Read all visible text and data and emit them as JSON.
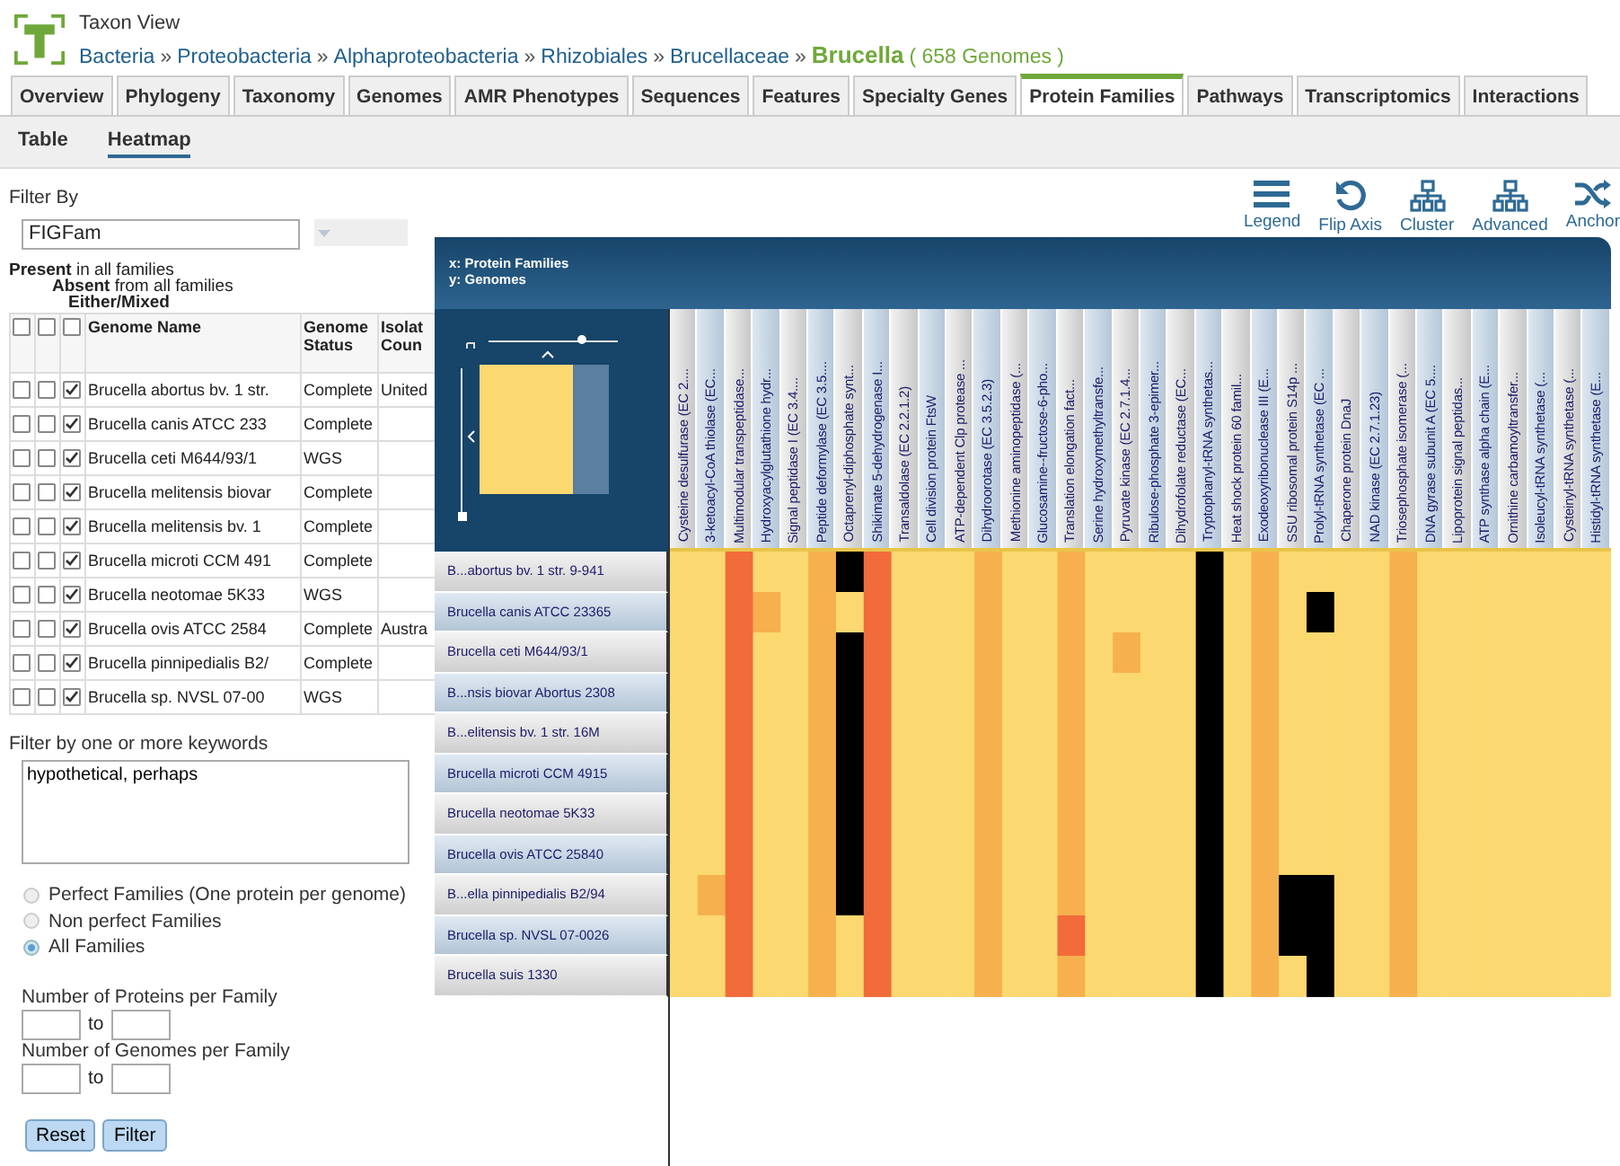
{
  "header": {
    "title": "Taxon View",
    "breadcrumb": [
      {
        "label": "Bacteria",
        "separator": "»"
      },
      {
        "label": "Proteobacteria",
        "separator": "»"
      },
      {
        "label": "Alphaproteobacteria",
        "separator": "»"
      },
      {
        "label": "Rhizobiales",
        "separator": "»"
      },
      {
        "label": "Brucellaceae",
        "separator": "»"
      }
    ],
    "taxon": "Brucella",
    "genome_count": "( 658 Genomes )"
  },
  "tabs": [
    {
      "label": "Overview",
      "selected": false
    },
    {
      "label": "Phylogeny",
      "selected": false
    },
    {
      "label": "Taxonomy",
      "selected": false
    },
    {
      "label": "Genomes",
      "selected": false
    },
    {
      "label": "AMR Phenotypes",
      "selected": false
    },
    {
      "label": "Sequences",
      "selected": false
    },
    {
      "label": "Features",
      "selected": false
    },
    {
      "label": "Specialty Genes",
      "selected": false
    },
    {
      "label": "Protein Families",
      "selected": true
    },
    {
      "label": "Pathways",
      "selected": false
    },
    {
      "label": "Transcriptomics",
      "selected": false
    },
    {
      "label": "Interactions",
      "selected": false
    }
  ],
  "subtabs": [
    {
      "label": "Table",
      "selected": false
    },
    {
      "label": "Heatmap",
      "selected": true
    }
  ],
  "filter": {
    "label": "Filter By",
    "select_value": "FIGFam",
    "legend": [
      "**Present** in all families",
      "**Absent** from all families",
      "**Either/Mixed**"
    ],
    "table": {
      "header_checks": [
        false,
        false,
        false
      ],
      "columns": [
        "Genome Name",
        "Genome Status",
        "Isolat Coun"
      ],
      "rows": [
        {
          "present": false,
          "absent": false,
          "mixed": true,
          "name": "Brucella abortus bv. 1 str.",
          "status": "Complete",
          "country": "United"
        },
        {
          "present": false,
          "absent": false,
          "mixed": true,
          "name": "Brucella canis ATCC 233",
          "status": "Complete",
          "country": ""
        },
        {
          "present": false,
          "absent": false,
          "mixed": true,
          "name": "Brucella ceti M644/93/1",
          "status": "WGS",
          "country": ""
        },
        {
          "present": false,
          "absent": false,
          "mixed": true,
          "name": "Brucella melitensis biovar",
          "status": "Complete",
          "country": ""
        },
        {
          "present": false,
          "absent": false,
          "mixed": true,
          "name": "Brucella melitensis bv. 1",
          "status": "Complete",
          "country": ""
        },
        {
          "present": false,
          "absent": false,
          "mixed": true,
          "name": "Brucella microti CCM 491",
          "status": "Complete",
          "country": ""
        },
        {
          "present": false,
          "absent": false,
          "mixed": true,
          "name": "Brucella neotomae 5K33",
          "status": "WGS",
          "country": ""
        },
        {
          "present": false,
          "absent": false,
          "mixed": true,
          "name": "Brucella ovis ATCC 2584",
          "status": "Complete",
          "country": "Austra"
        },
        {
          "present": false,
          "absent": false,
          "mixed": true,
          "name": "Brucella pinnipedialis B2/",
          "status": "Complete",
          "country": ""
        },
        {
          "present": false,
          "absent": false,
          "mixed": true,
          "name": "Brucella sp. NVSL 07-00",
          "status": "WGS",
          "country": ""
        }
      ]
    },
    "keywords_label": "Filter by one or more keywords",
    "keywords_value": "hypothetical, perhaps",
    "family_types": [
      {
        "label": "Perfect Families (One protein per genome)",
        "selected": false
      },
      {
        "label": "Non perfect Families",
        "selected": false
      },
      {
        "label": "All Families",
        "selected": true
      }
    ],
    "ranges": [
      {
        "label": "Number of Proteins per Family",
        "to": "to"
      },
      {
        "label": "Number of Genomes per Family",
        "to": "to"
      }
    ],
    "buttons": [
      "Reset",
      "Filter"
    ]
  },
  "toolbar": [
    "Legend",
    "Flip Axis",
    "Cluster",
    "Advanced",
    "Anchor"
  ],
  "heatmap": {
    "x_label": "x: Protein Families",
    "y_label": "y: Genomes",
    "columns": [
      "Cysteine desulfurase (EC 2....",
      "3-ketoacyl-CoA thiolase (EC...",
      "Multimodular transpeptidase...",
      "Hydroxyacylglutathione hydr...",
      "Signal peptidase I (EC 3.4....",
      "Peptide deformylase (EC 3.5....",
      "Octaprenyl-diphosphate synt...",
      "Shikimate 5-dehydrogenase I...",
      "Transaldolase (EC 2.2.1.2)",
      "Cell division protein FtsW",
      "ATP-dependent Clp protease ...",
      "Dihydroorotase (EC 3.5.2.3)",
      "Methionine aminopeptidase (...",
      "Glucosamine--fructose-6-pho...",
      "Translation elongation fact...",
      "Serine hydroxymethyltransfe...",
      "Pyruvate kinase (EC 2.7.1.4...",
      "Ribulose-phosphate 3-epimer...",
      "Dihydrofolate reductase (EC...",
      "Tryptophanyl-tRNA synthetas...",
      "Heat shock protein 60 famil...",
      "Exodeoxyribonuclease III (E...",
      "SSU ribosomal protein S14p ...",
      "Prolyl-tRNA synthetase (EC ...",
      "Chaperone protein DnaJ",
      "NAD kinase (EC 2.7.1.23)",
      "Triosephosphate isomerase (...",
      "DNA gyrase subunit A (EC 5....",
      "Lipoprotein signal peptidas...",
      "ATP synthase alpha chain (E...",
      "Ornithine carbamoyltransfer...",
      "Isoleucyl-tRNA synthetase (...",
      "Cysteinyl-tRNA synthetase (...",
      "Histidyl-tRNA synthetase (E..."
    ],
    "rows": [
      {
        "label": "B...abortus bv. 1 str. 9-941",
        "cells": [
          {
            "color": "#fcd870"
          },
          {
            "color": "#fcd870"
          },
          {
            "color": "#f26b3a"
          },
          {
            "color": "#fcd870"
          },
          {
            "color": "#fcd870"
          },
          {
            "color": "#f6b04e"
          },
          {
            "color": "#000000"
          },
          {
            "color": "#f26b3a"
          },
          {
            "color": "#fcd870"
          },
          {
            "color": "#fcd870"
          },
          {
            "color": "#fcd870"
          },
          {
            "color": "#f6b04e"
          },
          {
            "color": "#fcd870"
          },
          {
            "color": "#fcd870"
          },
          {
            "color": "#f6b04e"
          },
          {
            "color": "#fcd870"
          },
          {
            "color": "#fcd870"
          },
          {
            "color": "#fcd870"
          },
          {
            "color": "#fcd870"
          },
          {
            "color": "#000000"
          },
          {
            "color": "#fcd870"
          },
          {
            "color": "#f6b04e"
          },
          {
            "color": "#fcd870"
          },
          {
            "color": "#fcd870"
          },
          {
            "color": "#fcd870"
          },
          {
            "color": "#fcd870"
          },
          {
            "color": "#f6b04e"
          },
          {
            "color": "#fcd870"
          },
          {
            "color": "#fcd870"
          },
          {
            "color": "#fcd870"
          },
          {
            "color": "#fcd870"
          },
          {
            "color": "#fcd870"
          },
          {
            "color": "#fcd870"
          },
          {
            "color": "#fcd870"
          }
        ]
      },
      {
        "label": "Brucella canis ATCC 23365",
        "cells": [
          {
            "color": "#fcd870"
          },
          {
            "color": "#fcd870"
          },
          {
            "color": "#f26b3a"
          },
          {
            "color": "#f6b04e"
          },
          {
            "color": "#fcd870"
          },
          {
            "color": "#f6b04e"
          },
          {
            "color": "#fcd870"
          },
          {
            "color": "#f26b3a"
          },
          {
            "color": "#fcd870"
          },
          {
            "color": "#fcd870"
          },
          {
            "color": "#fcd870"
          },
          {
            "color": "#f6b04e"
          },
          {
            "color": "#fcd870"
          },
          {
            "color": "#fcd870"
          },
          {
            "color": "#f6b04e"
          },
          {
            "color": "#fcd870"
          },
          {
            "color": "#fcd870"
          },
          {
            "color": "#fcd870"
          },
          {
            "color": "#fcd870"
          },
          {
            "color": "#000000"
          },
          {
            "color": "#fcd870"
          },
          {
            "color": "#f6b04e"
          },
          {
            "color": "#fcd870"
          },
          {
            "color": "#000000"
          },
          {
            "color": "#fcd870"
          },
          {
            "color": "#fcd870"
          },
          {
            "color": "#f6b04e"
          },
          {
            "color": "#fcd870"
          },
          {
            "color": "#fcd870"
          },
          {
            "color": "#fcd870"
          },
          {
            "color": "#fcd870"
          },
          {
            "color": "#fcd870"
          },
          {
            "color": "#fcd870"
          },
          {
            "color": "#fcd870"
          }
        ]
      },
      {
        "label": "Brucella ceti M644/93/1",
        "cells": [
          {
            "color": "#fcd870"
          },
          {
            "color": "#fcd870"
          },
          {
            "color": "#f26b3a"
          },
          {
            "color": "#fcd870"
          },
          {
            "color": "#fcd870"
          },
          {
            "color": "#f6b04e"
          },
          {
            "color": "#000000"
          },
          {
            "color": "#f26b3a"
          },
          {
            "color": "#fcd870"
          },
          {
            "color": "#fcd870"
          },
          {
            "color": "#fcd870"
          },
          {
            "color": "#f6b04e"
          },
          {
            "color": "#fcd870"
          },
          {
            "color": "#fcd870"
          },
          {
            "color": "#f6b04e"
          },
          {
            "color": "#fcd870"
          },
          {
            "color": "#f6b04e"
          },
          {
            "color": "#fcd870"
          },
          {
            "color": "#fcd870"
          },
          {
            "color": "#000000"
          },
          {
            "color": "#fcd870"
          },
          {
            "color": "#f6b04e"
          },
          {
            "color": "#fcd870"
          },
          {
            "color": "#fcd870"
          },
          {
            "color": "#fcd870"
          },
          {
            "color": "#fcd870"
          },
          {
            "color": "#f6b04e"
          },
          {
            "color": "#fcd870"
          },
          {
            "color": "#fcd870"
          },
          {
            "color": "#fcd870"
          },
          {
            "color": "#fcd870"
          },
          {
            "color": "#fcd870"
          },
          {
            "color": "#fcd870"
          },
          {
            "color": "#fcd870"
          }
        ]
      },
      {
        "label": "B...nsis biovar Abortus 2308",
        "cells": [
          {
            "color": "#fcd870"
          },
          {
            "color": "#fcd870"
          },
          {
            "color": "#f26b3a"
          },
          {
            "color": "#fcd870"
          },
          {
            "color": "#fcd870"
          },
          {
            "color": "#f6b04e"
          },
          {
            "color": "#000000"
          },
          {
            "color": "#f26b3a"
          },
          {
            "color": "#fcd870"
          },
          {
            "color": "#fcd870"
          },
          {
            "color": "#fcd870"
          },
          {
            "color": "#f6b04e"
          },
          {
            "color": "#fcd870"
          },
          {
            "color": "#fcd870"
          },
          {
            "color": "#f6b04e"
          },
          {
            "color": "#fcd870"
          },
          {
            "color": "#fcd870"
          },
          {
            "color": "#fcd870"
          },
          {
            "color": "#fcd870"
          },
          {
            "color": "#000000"
          },
          {
            "color": "#fcd870"
          },
          {
            "color": "#f6b04e"
          },
          {
            "color": "#fcd870"
          },
          {
            "color": "#fcd870"
          },
          {
            "color": "#fcd870"
          },
          {
            "color": "#fcd870"
          },
          {
            "color": "#f6b04e"
          },
          {
            "color": "#fcd870"
          },
          {
            "color": "#fcd870"
          },
          {
            "color": "#fcd870"
          },
          {
            "color": "#fcd870"
          },
          {
            "color": "#fcd870"
          },
          {
            "color": "#fcd870"
          },
          {
            "color": "#fcd870"
          }
        ]
      },
      {
        "label": "B...elitensis bv. 1 str. 16M",
        "cells": [
          {
            "color": "#fcd870"
          },
          {
            "color": "#fcd870"
          },
          {
            "color": "#f26b3a"
          },
          {
            "color": "#fcd870"
          },
          {
            "color": "#fcd870"
          },
          {
            "color": "#f6b04e"
          },
          {
            "color": "#000000"
          },
          {
            "color": "#f26b3a"
          },
          {
            "color": "#fcd870"
          },
          {
            "color": "#fcd870"
          },
          {
            "color": "#fcd870"
          },
          {
            "color": "#f6b04e"
          },
          {
            "color": "#fcd870"
          },
          {
            "color": "#fcd870"
          },
          {
            "color": "#f6b04e"
          },
          {
            "color": "#fcd870"
          },
          {
            "color": "#fcd870"
          },
          {
            "color": "#fcd870"
          },
          {
            "color": "#fcd870"
          },
          {
            "color": "#000000"
          },
          {
            "color": "#fcd870"
          },
          {
            "color": "#f6b04e"
          },
          {
            "color": "#fcd870"
          },
          {
            "color": "#fcd870"
          },
          {
            "color": "#fcd870"
          },
          {
            "color": "#fcd870"
          },
          {
            "color": "#f6b04e"
          },
          {
            "color": "#fcd870"
          },
          {
            "color": "#fcd870"
          },
          {
            "color": "#fcd870"
          },
          {
            "color": "#fcd870"
          },
          {
            "color": "#fcd870"
          },
          {
            "color": "#fcd870"
          },
          {
            "color": "#fcd870"
          }
        ]
      },
      {
        "label": "Brucella microti CCM 4915",
        "cells": [
          {
            "color": "#fcd870"
          },
          {
            "color": "#fcd870"
          },
          {
            "color": "#f26b3a"
          },
          {
            "color": "#fcd870"
          },
          {
            "color": "#fcd870"
          },
          {
            "color": "#f6b04e"
          },
          {
            "color": "#000000"
          },
          {
            "color": "#f26b3a"
          },
          {
            "color": "#fcd870"
          },
          {
            "color": "#fcd870"
          },
          {
            "color": "#fcd870"
          },
          {
            "color": "#f6b04e"
          },
          {
            "color": "#fcd870"
          },
          {
            "color": "#fcd870"
          },
          {
            "color": "#f6b04e"
          },
          {
            "color": "#fcd870"
          },
          {
            "color": "#fcd870"
          },
          {
            "color": "#fcd870"
          },
          {
            "color": "#fcd870"
          },
          {
            "color": "#000000"
          },
          {
            "color": "#fcd870"
          },
          {
            "color": "#f6b04e"
          },
          {
            "color": "#fcd870"
          },
          {
            "color": "#fcd870"
          },
          {
            "color": "#fcd870"
          },
          {
            "color": "#fcd870"
          },
          {
            "color": "#f6b04e"
          },
          {
            "color": "#fcd870"
          },
          {
            "color": "#fcd870"
          },
          {
            "color": "#fcd870"
          },
          {
            "color": "#fcd870"
          },
          {
            "color": "#fcd870"
          },
          {
            "color": "#fcd870"
          },
          {
            "color": "#fcd870"
          }
        ]
      },
      {
        "label": "Brucella neotomae 5K33",
        "cells": [
          {
            "color": "#fcd870"
          },
          {
            "color": "#fcd870"
          },
          {
            "color": "#f26b3a"
          },
          {
            "color": "#fcd870"
          },
          {
            "color": "#fcd870"
          },
          {
            "color": "#f6b04e"
          },
          {
            "color": "#000000"
          },
          {
            "color": "#f26b3a"
          },
          {
            "color": "#fcd870"
          },
          {
            "color": "#fcd870"
          },
          {
            "color": "#fcd870"
          },
          {
            "color": "#f6b04e"
          },
          {
            "color": "#fcd870"
          },
          {
            "color": "#fcd870"
          },
          {
            "color": "#f6b04e"
          },
          {
            "color": "#fcd870"
          },
          {
            "color": "#fcd870"
          },
          {
            "color": "#fcd870"
          },
          {
            "color": "#fcd870"
          },
          {
            "color": "#000000"
          },
          {
            "color": "#fcd870"
          },
          {
            "color": "#f6b04e"
          },
          {
            "color": "#fcd870"
          },
          {
            "color": "#fcd870"
          },
          {
            "color": "#fcd870"
          },
          {
            "color": "#fcd870"
          },
          {
            "color": "#f6b04e"
          },
          {
            "color": "#fcd870"
          },
          {
            "color": "#fcd870"
          },
          {
            "color": "#fcd870"
          },
          {
            "color": "#fcd870"
          },
          {
            "color": "#fcd870"
          },
          {
            "color": "#fcd870"
          },
          {
            "color": "#fcd870"
          }
        ]
      },
      {
        "label": "Brucella ovis ATCC 25840",
        "cells": [
          {
            "color": "#fcd870"
          },
          {
            "color": "#fcd870"
          },
          {
            "color": "#f26b3a"
          },
          {
            "color": "#fcd870"
          },
          {
            "color": "#fcd870"
          },
          {
            "color": "#f6b04e"
          },
          {
            "color": "#000000"
          },
          {
            "color": "#f26b3a"
          },
          {
            "color": "#fcd870"
          },
          {
            "color": "#fcd870"
          },
          {
            "color": "#fcd870"
          },
          {
            "color": "#f6b04e"
          },
          {
            "color": "#fcd870"
          },
          {
            "color": "#fcd870"
          },
          {
            "color": "#f6b04e"
          },
          {
            "color": "#fcd870"
          },
          {
            "color": "#fcd870"
          },
          {
            "color": "#fcd870"
          },
          {
            "color": "#fcd870"
          },
          {
            "color": "#000000"
          },
          {
            "color": "#fcd870"
          },
          {
            "color": "#f6b04e"
          },
          {
            "color": "#fcd870"
          },
          {
            "color": "#fcd870"
          },
          {
            "color": "#fcd870"
          },
          {
            "color": "#fcd870"
          },
          {
            "color": "#f6b04e"
          },
          {
            "color": "#fcd870"
          },
          {
            "color": "#fcd870"
          },
          {
            "color": "#fcd870"
          },
          {
            "color": "#fcd870"
          },
          {
            "color": "#fcd870"
          },
          {
            "color": "#fcd870"
          },
          {
            "color": "#fcd870"
          }
        ]
      },
      {
        "label": "B...ella pinnipedialis B2/94",
        "cells": [
          {
            "color": "#fcd870"
          },
          {
            "color": "#f6b04e"
          },
          {
            "color": "#f26b3a"
          },
          {
            "color": "#fcd870"
          },
          {
            "color": "#fcd870"
          },
          {
            "color": "#f6b04e"
          },
          {
            "color": "#000000"
          },
          {
            "color": "#f26b3a"
          },
          {
            "color": "#fcd870"
          },
          {
            "color": "#fcd870"
          },
          {
            "color": "#fcd870"
          },
          {
            "color": "#f6b04e"
          },
          {
            "color": "#fcd870"
          },
          {
            "color": "#fcd870"
          },
          {
            "color": "#f6b04e"
          },
          {
            "color": "#fcd870"
          },
          {
            "color": "#fcd870"
          },
          {
            "color": "#fcd870"
          },
          {
            "color": "#fcd870"
          },
          {
            "color": "#000000"
          },
          {
            "color": "#fcd870"
          },
          {
            "color": "#f6b04e"
          },
          {
            "color": "#000000"
          },
          {
            "color": "#000000"
          },
          {
            "color": "#fcd870"
          },
          {
            "color": "#fcd870"
          },
          {
            "color": "#f6b04e"
          },
          {
            "color": "#fcd870"
          },
          {
            "color": "#fcd870"
          },
          {
            "color": "#fcd870"
          },
          {
            "color": "#fcd870"
          },
          {
            "color": "#fcd870"
          },
          {
            "color": "#fcd870"
          },
          {
            "color": "#fcd870"
          }
        ]
      },
      {
        "label": "Brucella sp. NVSL 07-0026",
        "cells": [
          {
            "color": "#fcd870"
          },
          {
            "color": "#fcd870"
          },
          {
            "color": "#f26b3a"
          },
          {
            "color": "#fcd870"
          },
          {
            "color": "#fcd870"
          },
          {
            "color": "#f6b04e"
          },
          {
            "color": "#fcd870"
          },
          {
            "color": "#f26b3a"
          },
          {
            "color": "#fcd870"
          },
          {
            "color": "#fcd870"
          },
          {
            "color": "#fcd870"
          },
          {
            "color": "#f6b04e"
          },
          {
            "color": "#fcd870"
          },
          {
            "color": "#fcd870"
          },
          {
            "color": "#f26b3a"
          },
          {
            "color": "#fcd870"
          },
          {
            "color": "#fcd870"
          },
          {
            "color": "#fcd870"
          },
          {
            "color": "#fcd870"
          },
          {
            "color": "#000000"
          },
          {
            "color": "#fcd870"
          },
          {
            "color": "#f6b04e"
          },
          {
            "color": "#000000"
          },
          {
            "color": "#000000"
          },
          {
            "color": "#fcd870"
          },
          {
            "color": "#fcd870"
          },
          {
            "color": "#f6b04e"
          },
          {
            "color": "#fcd870"
          },
          {
            "color": "#fcd870"
          },
          {
            "color": "#fcd870"
          },
          {
            "color": "#fcd870"
          },
          {
            "color": "#fcd870"
          },
          {
            "color": "#fcd870"
          },
          {
            "color": "#fcd870"
          }
        ]
      },
      {
        "label": "Brucella suis 1330",
        "cells": [
          {
            "color": "#fcd870"
          },
          {
            "color": "#fcd870"
          },
          {
            "color": "#f26b3a"
          },
          {
            "color": "#fcd870"
          },
          {
            "color": "#fcd870"
          },
          {
            "color": "#f6b04e"
          },
          {
            "color": "#fcd870"
          },
          {
            "color": "#f26b3a"
          },
          {
            "color": "#fcd870"
          },
          {
            "color": "#fcd870"
          },
          {
            "color": "#fcd870"
          },
          {
            "color": "#f6b04e"
          },
          {
            "color": "#fcd870"
          },
          {
            "color": "#fcd870"
          },
          {
            "color": "#f6b04e"
          },
          {
            "color": "#fcd870"
          },
          {
            "color": "#fcd870"
          },
          {
            "color": "#fcd870"
          },
          {
            "color": "#fcd870"
          },
          {
            "color": "#000000"
          },
          {
            "color": "#fcd870"
          },
          {
            "color": "#f6b04e"
          },
          {
            "color": "#fcd870"
          },
          {
            "color": "#000000"
          },
          {
            "color": "#fcd870"
          },
          {
            "color": "#fcd870"
          },
          {
            "color": "#f6b04e"
          },
          {
            "color": "#fcd870"
          },
          {
            "color": "#fcd870"
          },
          {
            "color": "#fcd870"
          },
          {
            "color": "#fcd870"
          },
          {
            "color": "#fcd870"
          },
          {
            "color": "#fcd870"
          },
          {
            "color": "#fcd870"
          }
        ]
      }
    ]
  }
}
